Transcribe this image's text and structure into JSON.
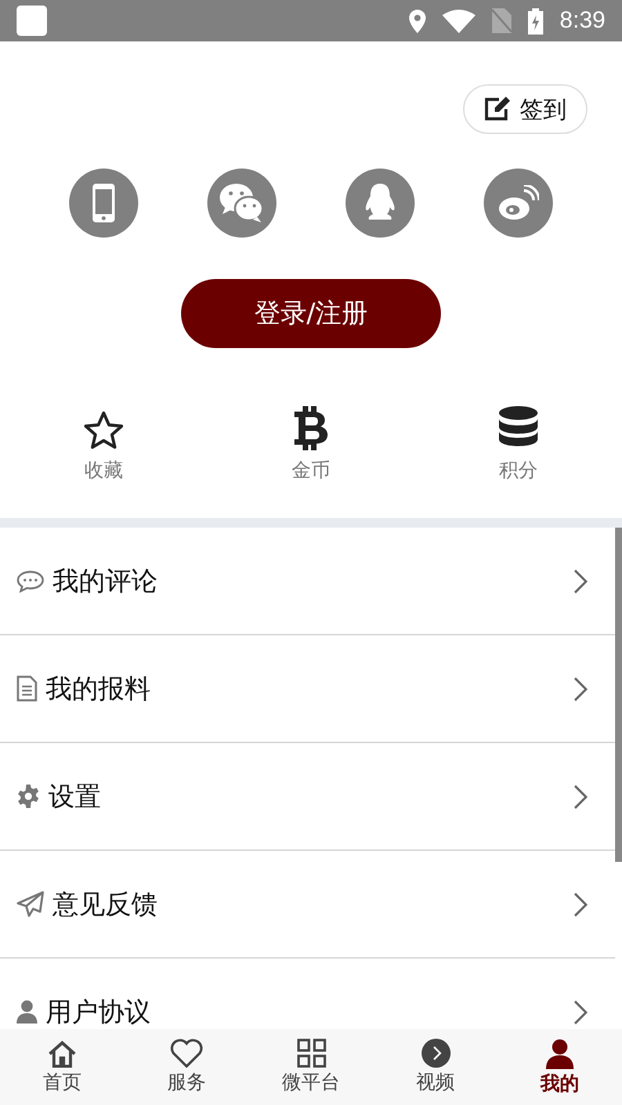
{
  "status_bar": {
    "time": "8:39"
  },
  "checkin_button": {
    "label": "签到"
  },
  "login_options": [
    {
      "kind": "phone"
    },
    {
      "kind": "wechat"
    },
    {
      "kind": "qq"
    },
    {
      "kind": "weibo"
    }
  ],
  "login_button": {
    "label": "登录/注册"
  },
  "stats": [
    {
      "kind": "star",
      "label": "收藏"
    },
    {
      "kind": "coin",
      "label": "金币"
    },
    {
      "kind": "stack",
      "label": "积分"
    }
  ],
  "menu": [
    {
      "kind": "comment",
      "label": "我的评论"
    },
    {
      "kind": "document",
      "label": "我的报料"
    },
    {
      "kind": "gear",
      "label": "设置"
    },
    {
      "kind": "send",
      "label": "意见反馈"
    },
    {
      "kind": "user",
      "label": "用户协议"
    }
  ],
  "tab_bar": [
    {
      "kind": "home",
      "label": "首页",
      "selected": false
    },
    {
      "kind": "heart",
      "label": "服务",
      "selected": false
    },
    {
      "kind": "grid",
      "label": "微平台",
      "selected": false
    },
    {
      "kind": "play",
      "label": "视频",
      "selected": false
    },
    {
      "kind": "user",
      "label": "我的",
      "selected": true
    }
  ]
}
